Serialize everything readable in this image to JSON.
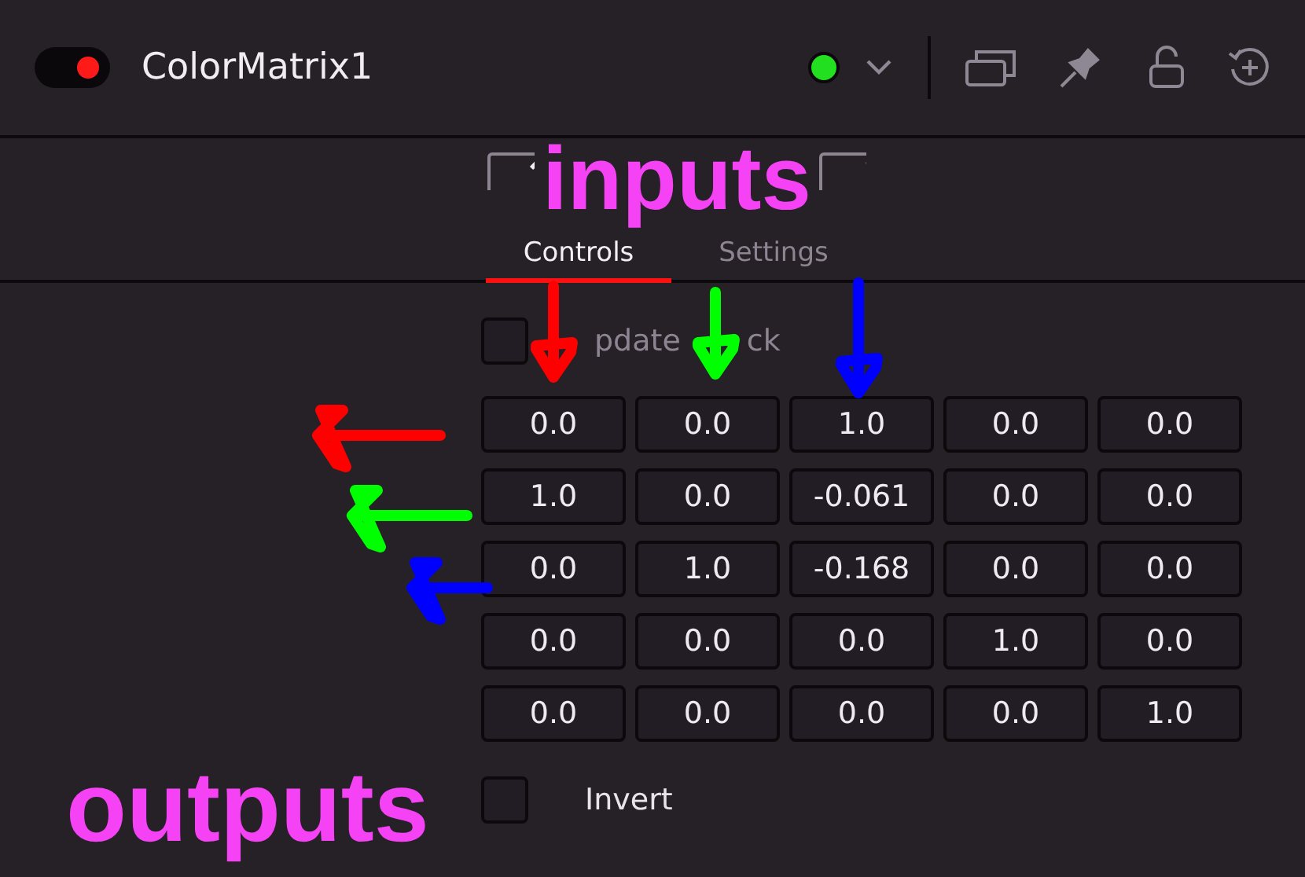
{
  "header": {
    "toggle": {
      "on": true
    },
    "title": "ColorMatrix1",
    "status_dot": {
      "color": "#22e01f"
    }
  },
  "tabs": [
    {
      "label": "Controls",
      "selected": true
    },
    {
      "label": "Settings",
      "selected": false
    }
  ],
  "update_lock": {
    "label_parts": [
      "pdate",
      "ck"
    ],
    "checked": false
  },
  "matrix": [
    [
      "0.0",
      "0.0",
      "1.0",
      "0.0",
      "0.0"
    ],
    [
      "1.0",
      "0.0",
      "-0.061",
      "0.0",
      "0.0"
    ],
    [
      "0.0",
      "1.0",
      "-0.168",
      "0.0",
      "0.0"
    ],
    [
      "0.0",
      "0.0",
      "0.0",
      "1.0",
      "0.0"
    ],
    [
      "0.0",
      "0.0",
      "0.0",
      "0.0",
      "1.0"
    ]
  ],
  "invert": {
    "label": "Invert",
    "checked": false
  },
  "annotations": {
    "texts": [
      {
        "kind": "inputs",
        "text": "inputs"
      },
      {
        "kind": "outputs",
        "text": "outputs"
      }
    ],
    "arrows": [
      {
        "kind": "down",
        "color": "#ff0000"
      },
      {
        "kind": "down",
        "color": "#00ff00"
      },
      {
        "kind": "down",
        "color": "#0000ff"
      },
      {
        "kind": "left",
        "color": "#ff0000"
      },
      {
        "kind": "left",
        "color": "#00ff00"
      },
      {
        "kind": "left",
        "color": "#0000ff"
      }
    ]
  }
}
